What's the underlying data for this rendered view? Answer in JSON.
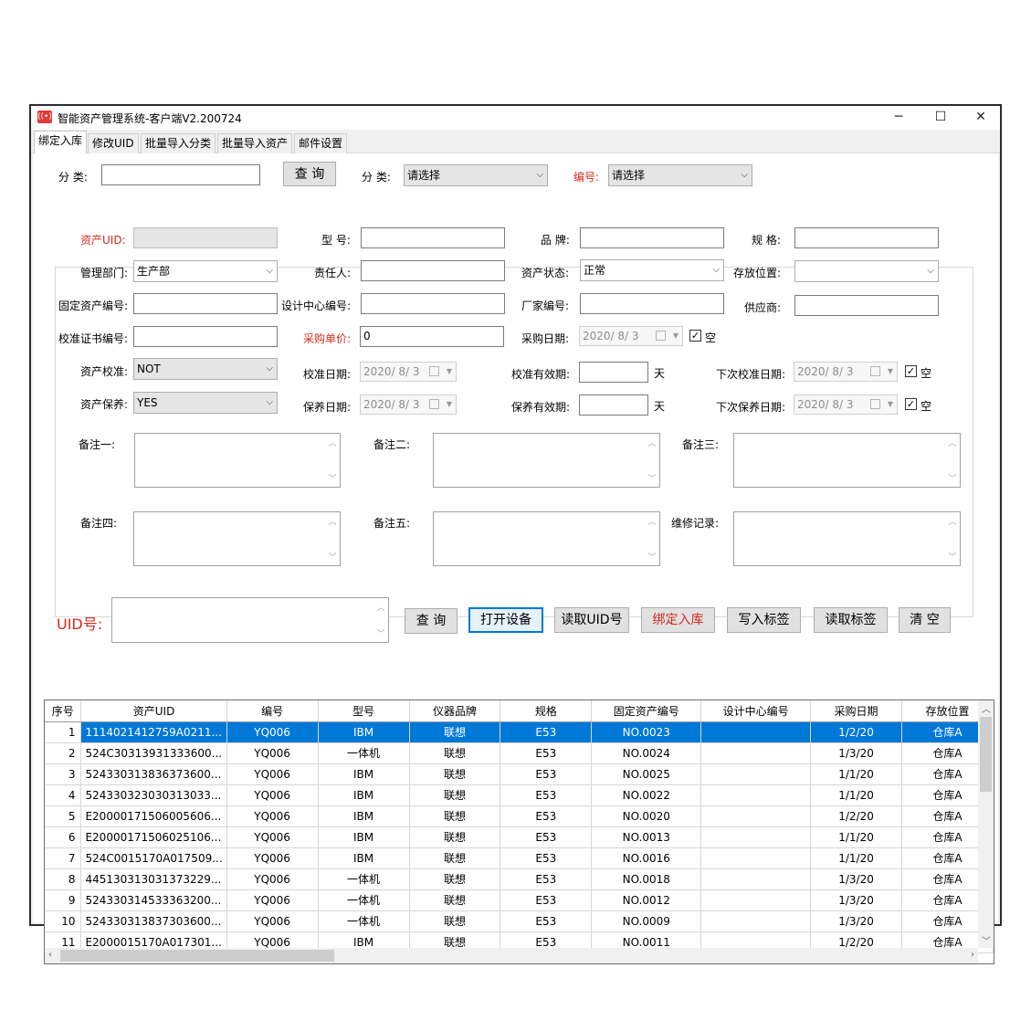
{
  "window": {
    "title": "智能资产管理系统-客户端V2.200724",
    "minimize": "─",
    "maximize": "☐",
    "close": "✕"
  },
  "tabs": [
    "绑定入库",
    "修改UID",
    "批量导入分类",
    "批量导入资产",
    "邮件设置"
  ],
  "search": {
    "category_label": "分 类:",
    "category_value": "",
    "query_button": "查 询",
    "category2_label": "分 类:",
    "category2_value": "请选择",
    "code_label": "编号:",
    "code_value": "请选择"
  },
  "form": {
    "asset_uid_label": "资产UID:",
    "asset_uid_value": "",
    "model_label": "型 号:",
    "model_value": "",
    "brand_label": "品 牌:",
    "brand_value": "",
    "spec_label": "规 格:",
    "spec_value": "",
    "dept_label": "管理部门:",
    "dept_value": "生产部",
    "owner_label": "责任人:",
    "owner_value": "",
    "status_label": "资产状态:",
    "status_value": "正常",
    "location_label": "存放位置:",
    "location_value": "",
    "fixed_no_label": "固定资产编号:",
    "fixed_no_value": "",
    "design_no_label": "设计中心编号:",
    "design_no_value": "",
    "maker_no_label": "厂家编号:",
    "maker_no_value": "",
    "supplier_label": "供应商:",
    "supplier_value": "",
    "cert_no_label": "校准证书编号:",
    "cert_no_value": "",
    "price_label": "采购单价:",
    "price_value": "0",
    "purchase_date_label": "采购日期:",
    "purchase_date_value": "2020/ 8/ 3",
    "purchase_empty_label": "空",
    "calib_label": "资产校准:",
    "calib_value": "NOT",
    "calib_date_label": "校准日期:",
    "calib_date_value": "2020/ 8/ 3",
    "calib_valid_label": "校准有效期:",
    "calib_valid_value": "",
    "calib_unit": "天",
    "next_calib_label": "下次校准日期:",
    "next_calib_value": "2020/ 8/ 3",
    "next_calib_empty_label": "空",
    "maint_label": "资产保养:",
    "maint_value": "YES",
    "maint_date_label": "保养日期:",
    "maint_date_value": "2020/ 8/ 3",
    "maint_valid_label": "保养有效期:",
    "maint_valid_value": "",
    "maint_unit": "天",
    "next_maint_label": "下次保养日期:",
    "next_maint_value": "2020/ 8/ 3",
    "next_maint_empty_label": "空",
    "note1_label": "备注一:",
    "note2_label": "备注二:",
    "note3_label": "备注三:",
    "note4_label": "备注四:",
    "note5_label": "备注五:",
    "repair_label": "维修记录:"
  },
  "actions": {
    "uid_label": "UID号:",
    "uid_value": "",
    "query": "查 询",
    "open_device": "打开设备",
    "read_uid": "读取UID号",
    "bind": "绑定入库",
    "write_tag": "写入标签",
    "read_tag": "读取标签",
    "clear": "清 空"
  },
  "table": {
    "columns": [
      "序号",
      "资产UID",
      "编号",
      "型号",
      "仪器品牌",
      "规格",
      "固定资产编号",
      "设计中心编号",
      "采购日期",
      "存放位置"
    ],
    "rows": [
      [
        "1",
        "1114021412759A0211...",
        "YQ006",
        "IBM",
        "联想",
        "E53",
        "NO.0023",
        "",
        "1/2/20",
        "仓库A"
      ],
      [
        "2",
        "524C30313931333600...",
        "YQ006",
        "一体机",
        "联想",
        "E53",
        "NO.0024",
        "",
        "1/3/20",
        "仓库A"
      ],
      [
        "3",
        "524330313836373600...",
        "YQ006",
        "IBM",
        "联想",
        "E53",
        "NO.0025",
        "",
        "1/1/20",
        "仓库A"
      ],
      [
        "4",
        "524330323030313033...",
        "YQ006",
        "IBM",
        "联想",
        "E53",
        "NO.0022",
        "",
        "1/1/20",
        "仓库A"
      ],
      [
        "5",
        "E20000171506005606...",
        "YQ006",
        "IBM",
        "联想",
        "E53",
        "NO.0020",
        "",
        "1/2/20",
        "仓库A"
      ],
      [
        "6",
        "E20000171506025106...",
        "YQ006",
        "IBM",
        "联想",
        "E53",
        "NO.0013",
        "",
        "1/1/20",
        "仓库A"
      ],
      [
        "7",
        "524C0015170A017509...",
        "YQ006",
        "IBM",
        "联想",
        "E53",
        "NO.0016",
        "",
        "1/1/20",
        "仓库A"
      ],
      [
        "8",
        "445130313031373229...",
        "YQ006",
        "一体机",
        "联想",
        "E53",
        "NO.0018",
        "",
        "1/3/20",
        "仓库A"
      ],
      [
        "9",
        "524330314533363200...",
        "YQ006",
        "一体机",
        "联想",
        "E53",
        "NO.0012",
        "",
        "1/3/20",
        "仓库A"
      ],
      [
        "10",
        "524330313837303600...",
        "YQ006",
        "一体机",
        "联想",
        "E53",
        "NO.0009",
        "",
        "1/3/20",
        "仓库A"
      ],
      [
        "11",
        "E2000015170A017301...",
        "YQ006",
        "IBM",
        "联想",
        "E53",
        "NO.0011",
        "",
        "1/2/20",
        "仓库A"
      ]
    ],
    "selected_row": 0
  },
  "colors": {
    "selection": "#0078d7",
    "required_label": "#d42a1f",
    "focus_border": "#0078d7"
  }
}
